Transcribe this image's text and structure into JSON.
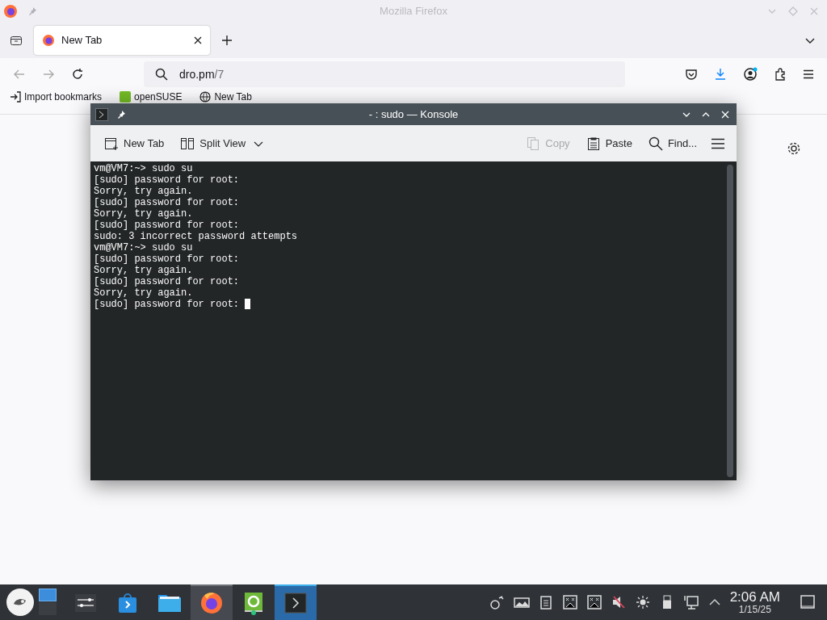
{
  "browser": {
    "window_title": "Mozilla Firefox",
    "tabs": [
      {
        "label": "New Tab",
        "selected": true
      }
    ],
    "address": {
      "host": "dro.pm",
      "path": "/7"
    },
    "bookmarks": [
      {
        "label": "Import bookmarks",
        "kind": "import"
      },
      {
        "label": "openSUSE",
        "kind": "site"
      },
      {
        "label": "New Tab",
        "kind": "page"
      }
    ]
  },
  "konsole": {
    "title": "- : sudo — Konsole",
    "toolbar": [
      {
        "label": "New Tab",
        "kind": "new-tab",
        "disabled": false
      },
      {
        "label": "Split View",
        "kind": "split",
        "disabled": false
      },
      {
        "label": "Copy",
        "kind": "copy",
        "disabled": true
      },
      {
        "label": "Paste",
        "kind": "paste",
        "disabled": false
      },
      {
        "label": "Find...",
        "kind": "find",
        "disabled": false
      }
    ],
    "lines": [
      "vm@VM7:~> sudo su",
      "[sudo] password for root:",
      "Sorry, try again.",
      "[sudo] password for root:",
      "Sorry, try again.",
      "[sudo] password for root:",
      "sudo: 3 incorrect password attempts",
      "vm@VM7:~> sudo su",
      "[sudo] password for root:",
      "Sorry, try again.",
      "[sudo] password for root:",
      "Sorry, try again.",
      "[sudo] password for root: "
    ]
  },
  "taskbar": {
    "tasks": [
      {
        "kind": "settings",
        "selected": false
      },
      {
        "kind": "store",
        "selected": false
      },
      {
        "kind": "files",
        "selected": false
      },
      {
        "kind": "firefox",
        "selected": false,
        "open": true
      },
      {
        "kind": "installer",
        "selected": false,
        "open": false
      },
      {
        "kind": "konsole",
        "selected": true
      }
    ],
    "time": "2:06 AM",
    "date": "1/15/25"
  }
}
